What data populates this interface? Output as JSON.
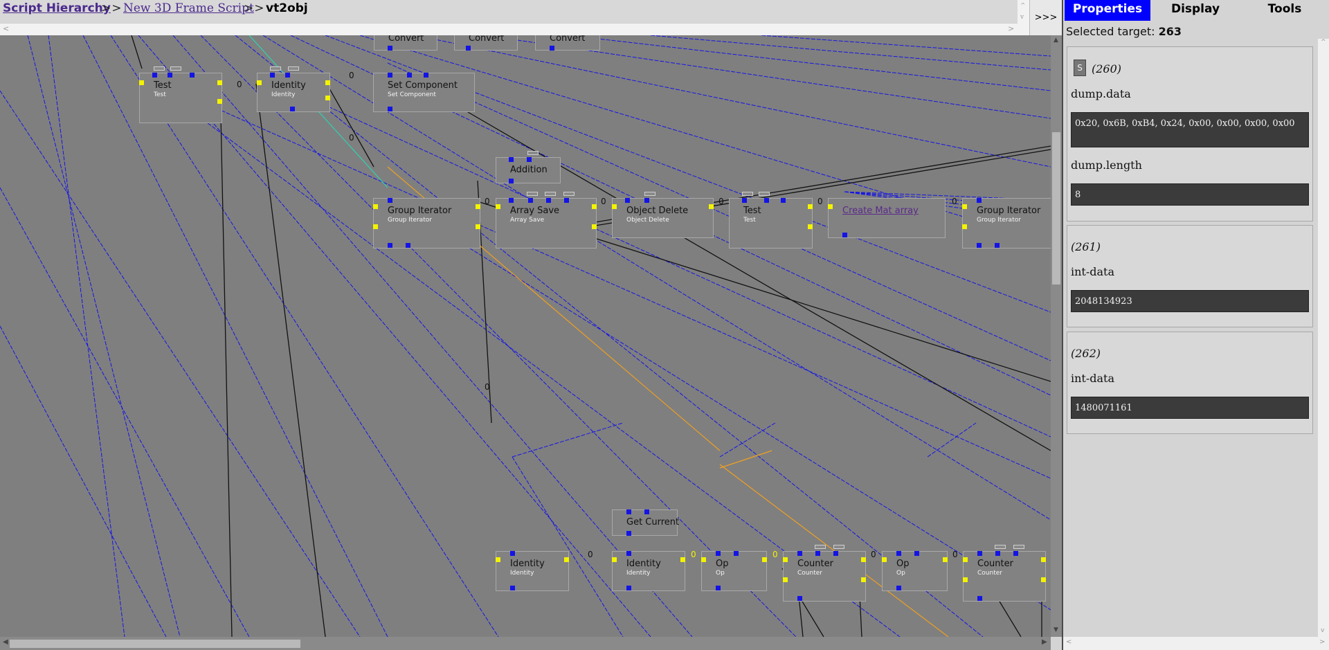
{
  "breadcrumb": {
    "root": "Script Hierarchy",
    "separator": ">>",
    "parent": "New 3D Frame Script",
    "current": "vt2obj"
  },
  "expand_button": ">>>",
  "panel": {
    "tabs": [
      "Properties",
      "Display",
      "Tools"
    ],
    "active_tab": "Properties",
    "selected_label": "Selected target:",
    "selected_value": "263",
    "items": [
      {
        "index": "(260)",
        "fields": [
          {
            "name": "dump.data",
            "value": "0x20, 0x6B, 0xB4, 0x24, 0x00, 0x00, 0x00, 0x00"
          },
          {
            "name": "dump.length",
            "value": "8"
          }
        ],
        "button": "S"
      },
      {
        "index": "(261)",
        "fields": [
          {
            "name": "int-data",
            "value": "2048134923"
          }
        ]
      },
      {
        "index": "(262)",
        "fields": [
          {
            "name": "int-data",
            "value": "1480071161"
          }
        ]
      }
    ]
  },
  "graph": {
    "nodes": [
      {
        "id": "convert1",
        "title": "Convert",
        "subtitle": ""
      },
      {
        "id": "convert2",
        "title": "Convert",
        "subtitle": ""
      },
      {
        "id": "convert3",
        "title": "Convert",
        "subtitle": ""
      },
      {
        "id": "test1",
        "title": "Test",
        "subtitle": "Test"
      },
      {
        "id": "identity1",
        "title": "Identity",
        "subtitle": "Identity"
      },
      {
        "id": "setcomp",
        "title": "Set Component",
        "subtitle": "Set Component"
      },
      {
        "id": "addition",
        "title": "Addition",
        "subtitle": ""
      },
      {
        "id": "groupiter1",
        "title": "Group Iterator",
        "subtitle": "Group Iterator"
      },
      {
        "id": "arraysave",
        "title": "Array Save",
        "subtitle": "Array Save"
      },
      {
        "id": "objdelete",
        "title": "Object Delete",
        "subtitle": "Object Delete"
      },
      {
        "id": "test2",
        "title": "Test",
        "subtitle": "Test"
      },
      {
        "id": "creatematarray",
        "title": "Create Mat array",
        "subtitle": ""
      },
      {
        "id": "groupiter2",
        "title": "Group Iterator",
        "subtitle": "Group Iterator"
      },
      {
        "id": "getcurrent",
        "title": "Get Current",
        "subtitle": ""
      },
      {
        "id": "identity2",
        "title": "Identity",
        "subtitle": "Identity"
      },
      {
        "id": "identity3",
        "title": "Identity",
        "subtitle": "Identity"
      },
      {
        "id": "op1",
        "title": "Op",
        "subtitle": "Op"
      },
      {
        "id": "counter1",
        "title": "Counter",
        "subtitle": "Counter"
      },
      {
        "id": "op2",
        "title": "Op",
        "subtitle": "Op"
      },
      {
        "id": "counter2",
        "title": "Counter",
        "subtitle": "Counter"
      }
    ],
    "wire_labels": [
      "0",
      "0",
      "0",
      "0",
      "0",
      "0",
      "0",
      "0",
      "0",
      "0",
      "0",
      "0",
      "0",
      "0",
      "0",
      "0"
    ]
  },
  "colors": {
    "canvas": "#7f7f7f",
    "active_tab": "#0000ff",
    "wire_data": "#1414e6",
    "wire_flow": "#111111",
    "wire_orange": "#f0a020"
  }
}
